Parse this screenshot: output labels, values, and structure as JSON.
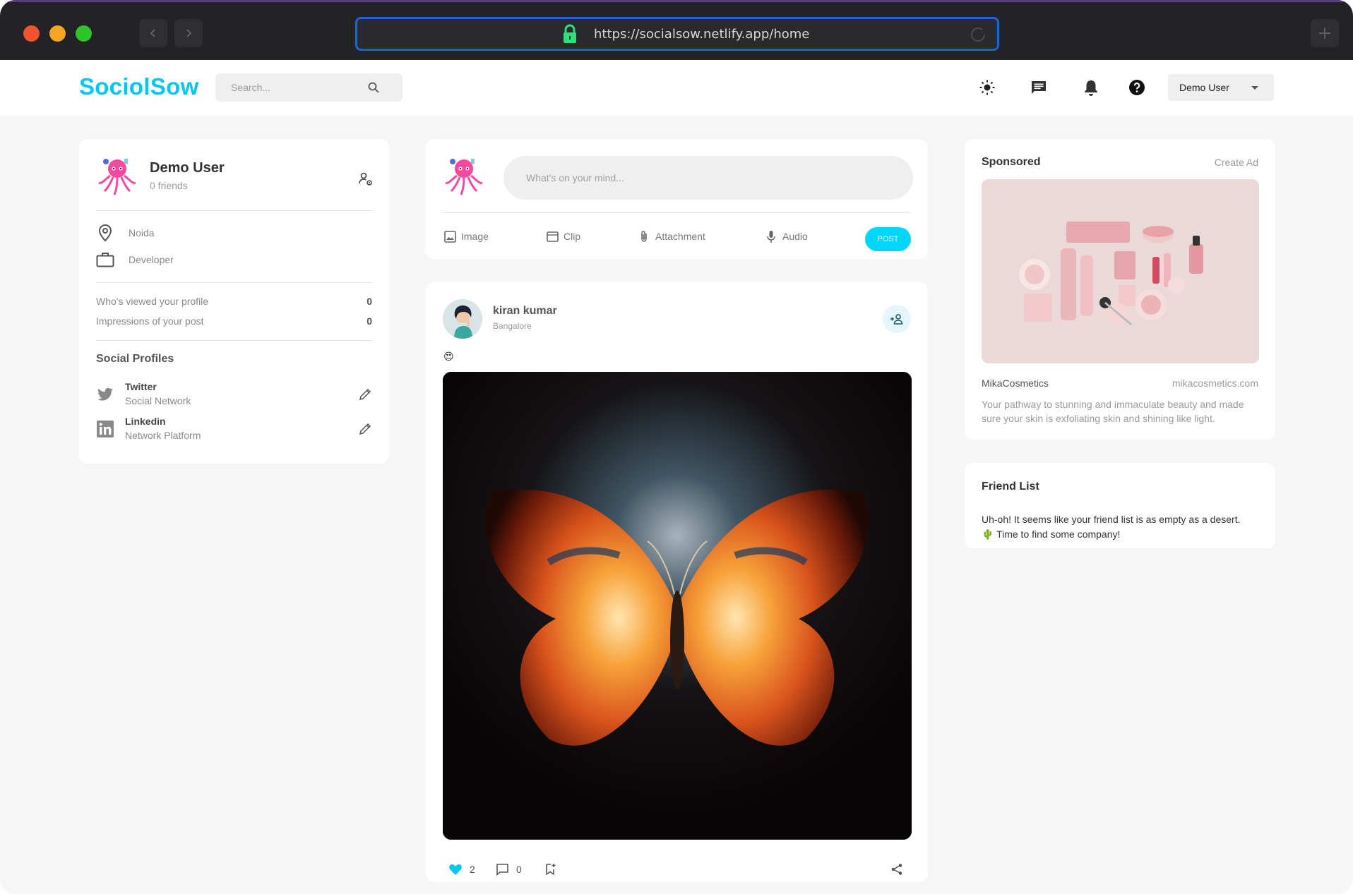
{
  "browser": {
    "url": "https://socialsow.netlify.app/home"
  },
  "nav": {
    "logo": "SociolSow",
    "search_placeholder": "Search...",
    "user_menu": "Demo User"
  },
  "profile": {
    "name": "Demo User",
    "friends": "0 friends",
    "location": "Noida",
    "occupation": "Developer",
    "stats": [
      {
        "label": "Who's viewed your profile",
        "value": "0"
      },
      {
        "label": "Impressions of your post",
        "value": "0"
      }
    ],
    "social_title": "Social Profiles",
    "socials": [
      {
        "name": "Twitter",
        "type": "Social Network",
        "icon": "twitter-icon"
      },
      {
        "name": "Linkedin",
        "type": "Network Platform",
        "icon": "linkedin-icon"
      }
    ]
  },
  "composer": {
    "placeholder": "What's on your mind...",
    "actions": [
      {
        "label": "Image",
        "icon": "image-icon"
      },
      {
        "label": "Clip",
        "icon": "clip-icon"
      },
      {
        "label": "Attachment",
        "icon": "paperclip-icon"
      },
      {
        "label": "Audio",
        "icon": "microphone-icon"
      }
    ],
    "post_label": "POST"
  },
  "post": {
    "author": "kiran kumar",
    "location": "Bangalore",
    "emoji": "😍",
    "likes": "2",
    "comments": "0"
  },
  "sponsored": {
    "title": "Sponsored",
    "create_ad": "Create Ad",
    "brand": "MikaCosmetics",
    "url": "mikacosmetics.com",
    "description": "Your pathway to stunning and immaculate beauty and made sure your skin is exfoliating skin and shining like light."
  },
  "friend_list": {
    "title": "Friend List",
    "empty_line1": "Uh-oh! It seems like your friend list is as empty as a desert.",
    "empty_line2": "🌵 Time to find some company!"
  },
  "colors": {
    "accent": "#00c6f0",
    "post_button": "#00d5fa",
    "browser_chrome": "#232325",
    "url_border": "#1b63d6"
  }
}
